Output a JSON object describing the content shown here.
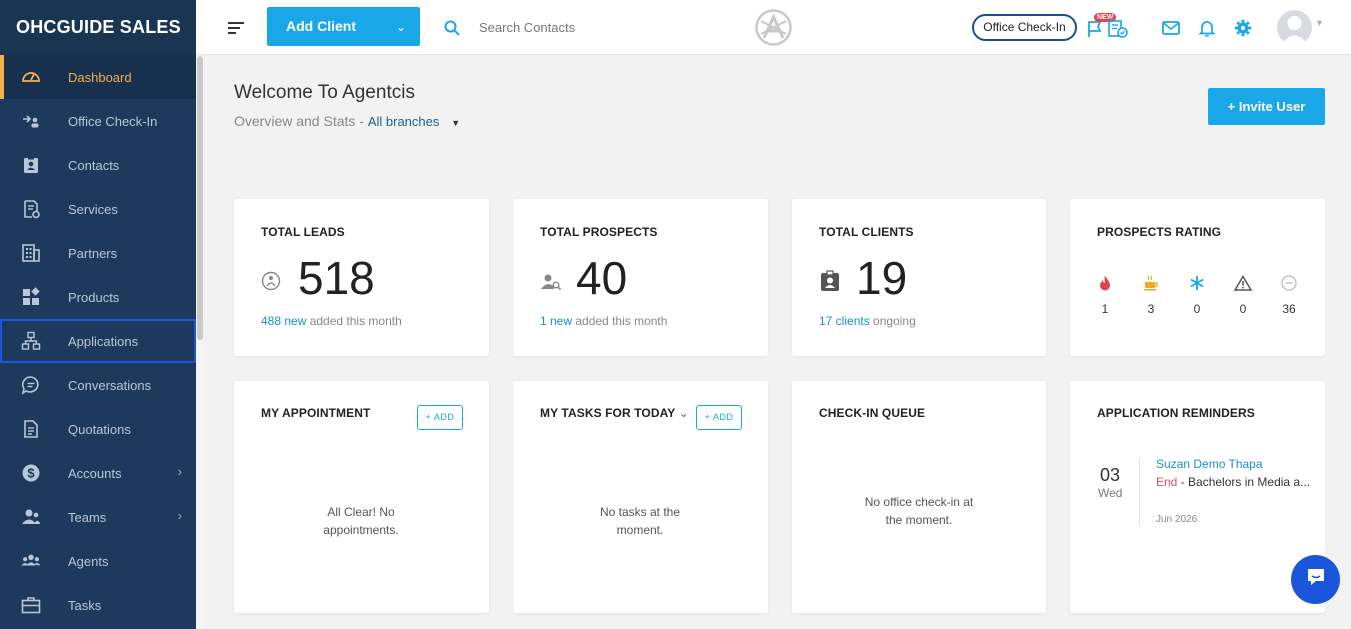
{
  "brand": "OHCGUIDE SALES",
  "sidebar": {
    "items": [
      {
        "label": "Dashboard"
      },
      {
        "label": "Office Check-In"
      },
      {
        "label": "Contacts"
      },
      {
        "label": "Services"
      },
      {
        "label": "Partners"
      },
      {
        "label": "Products"
      },
      {
        "label": "Applications"
      },
      {
        "label": "Conversations"
      },
      {
        "label": "Quotations"
      },
      {
        "label": "Accounts"
      },
      {
        "label": "Teams"
      },
      {
        "label": "Agents"
      },
      {
        "label": "Tasks"
      }
    ]
  },
  "header": {
    "add_client": "Add Client",
    "search_placeholder": "Search Contacts",
    "office_checkin": "Office Check-In",
    "new_badge": "NEW"
  },
  "welcome": {
    "title": "Welcome To Agentcis",
    "overview": "Overview and Stats -",
    "branch": "All branches",
    "invite_user": "+  Invite User"
  },
  "stats": {
    "leads": {
      "title": "TOTAL LEADS",
      "value": "518",
      "link": "488 new",
      "rest": " added this month"
    },
    "prospects": {
      "title": "TOTAL PROSPECTS",
      "value": "40",
      "link": "1 new",
      "rest": " added this month"
    },
    "clients": {
      "title": "TOTAL CLIENTS",
      "value": "19",
      "link": "17 clients",
      "rest": " ongoing"
    },
    "rating": {
      "title": "PROSPECTS RATING",
      "items": [
        {
          "icon": "fire-icon",
          "value": "1",
          "color": "#e0454b"
        },
        {
          "icon": "coffee-icon",
          "value": "3",
          "color": "#f5a623"
        },
        {
          "icon": "snowflake-icon",
          "value": "0",
          "color": "#19a7e8"
        },
        {
          "icon": "warning-icon",
          "value": "0",
          "color": "#555555"
        },
        {
          "icon": "minus-circle-icon",
          "value": "36",
          "color": "#bbbbbb"
        }
      ]
    }
  },
  "panels": {
    "appointment": {
      "title": "MY APPOINTMENT",
      "add": "+ ADD",
      "empty": "All Clear! No appointments."
    },
    "tasks": {
      "title": "MY TASKS FOR  TODAY",
      "add": "+ ADD",
      "empty": "No tasks at the moment."
    },
    "checkin": {
      "title": "CHECK-IN QUEUE",
      "empty": "No office check-in at the moment."
    },
    "reminders": {
      "title": "APPLICATION REMINDERS",
      "day": "03",
      "weekday": "Wed",
      "name": "Suzan Demo Thapa",
      "status": "End",
      "desc": " - Bachelors in Media a...",
      "date": "Jun 2026"
    }
  },
  "colors": {
    "accent": "#19a7e8",
    "sidebar": "#1d3a5c",
    "active": "#f5b04a"
  }
}
